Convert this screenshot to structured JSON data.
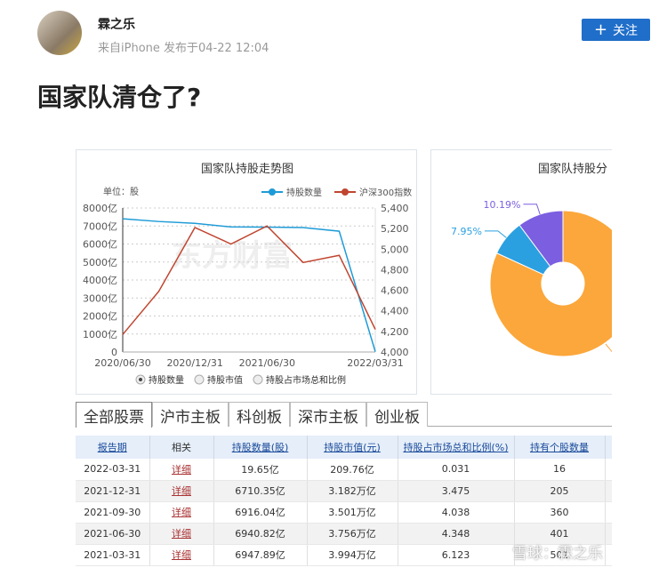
{
  "post": {
    "author": "霖之乐",
    "meta": "来自iPhone  发布于04-22 12:04",
    "follow_label": "关注",
    "title": "国家队清仓了?"
  },
  "line_chart": {
    "title": "国家队持股走势图",
    "unit": "单位：股",
    "legend": [
      "持股数量",
      "沪深300指数"
    ],
    "left_ticks": [
      "0",
      "1000亿",
      "2000亿",
      "3000亿",
      "4000亿",
      "5000亿",
      "6000亿",
      "7000亿",
      "8000亿"
    ],
    "right_ticks": [
      "4,000",
      "4,200",
      "4,400",
      "4,600",
      "4,800",
      "5,000",
      "5,200",
      "5,400"
    ],
    "x_labels": [
      "2020/06/30",
      "2020/12/31",
      "2021/06/30",
      "2022/03/31"
    ],
    "radio": [
      "持股数量",
      "持股市值",
      "持股占市场总和比例"
    ],
    "watermark": "东方财富"
  },
  "chart_data": [
    {
      "type": "line",
      "title": "国家队持股走势图",
      "ylabel": "单位：股",
      "x": [
        "2020/06/30",
        "2020/09/30",
        "2020/12/31",
        "2021/03/31",
        "2021/06/30",
        "2021/09/30",
        "2021/12/31",
        "2022/03/31"
      ],
      "series": [
        {
          "name": "持股数量",
          "axis": "left",
          "unit": "亿",
          "values": [
            7400,
            7250,
            7150,
            6947.89,
            6940.82,
            6916.04,
            6710.35,
            19.65
          ],
          "color": "#1e9bd7"
        },
        {
          "name": "沪深300指数",
          "axis": "right",
          "values": [
            4170,
            4590,
            5210,
            5050,
            5225,
            4870,
            4940,
            4220
          ],
          "color": "#c0452f"
        }
      ],
      "ylim_left": [
        0,
        8000
      ],
      "ylim_right": [
        4000,
        5400
      ],
      "grid": true,
      "legend": "top-right"
    },
    {
      "type": "pie",
      "title": "国家队持股分",
      "slices": [
        {
          "label": "10.19%",
          "value": 10.19,
          "color": "#7b5fe0"
        },
        {
          "label": "7.95%",
          "value": 7.95,
          "color": "#2ba0e0"
        },
        {
          "label": "",
          "value": 81.86,
          "color": "#fba73b"
        }
      ]
    }
  ],
  "pie_title": "国家队持股分",
  "tabs": [
    "全部股票",
    "沪市主板",
    "科创板",
    "深市主板",
    "创业板"
  ],
  "table": {
    "headers": [
      "报告期",
      "相关",
      "持股数量(股)",
      "持股市值(元)",
      "持股占市场总和比例(%)",
      "持有个股数量"
    ],
    "rows": [
      [
        "2022-03-31",
        "详细",
        "19.65亿",
        "209.76亿",
        "0.031",
        "16"
      ],
      [
        "2021-12-31",
        "详细",
        "6710.35亿",
        "3.182万亿",
        "3.475",
        "205"
      ],
      [
        "2021-09-30",
        "详细",
        "6916.04亿",
        "3.501万亿",
        "4.038",
        "360"
      ],
      [
        "2021-06-30",
        "详细",
        "6940.82亿",
        "3.756万亿",
        "4.348",
        "401"
      ],
      [
        "2021-03-31",
        "详细",
        "6947.89亿",
        "3.994万亿",
        "6.123",
        "501"
      ]
    ]
  },
  "watermark": "雪球：霖之乐"
}
